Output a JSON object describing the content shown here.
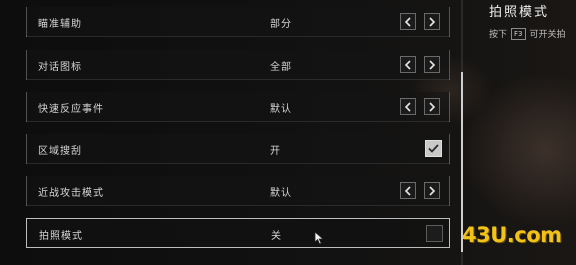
{
  "settings": {
    "rows": [
      {
        "label": "瞄准辅助",
        "value": "部分",
        "type": "selector"
      },
      {
        "label": "对话图标",
        "value": "全部",
        "type": "selector"
      },
      {
        "label": "快速反应事件",
        "value": "默认",
        "type": "selector"
      },
      {
        "label": "区域搜刮",
        "value": "开",
        "type": "toggle",
        "checked": true
      },
      {
        "label": "近战攻击模式",
        "value": "默认",
        "type": "selector"
      },
      {
        "label": "拍照模式",
        "value": "关",
        "type": "toggle",
        "checked": false
      }
    ],
    "selected_index": 5
  },
  "side_panel": {
    "title": "拍照模式",
    "hint_prefix": "按下",
    "hint_key": "F3",
    "hint_suffix": "可开关拍"
  },
  "watermark": {
    "text": "43U.com"
  },
  "icons": {
    "left_arrow": "chevron-left-icon",
    "right_arrow": "chevron-right-icon",
    "check": "checkmark-icon",
    "cursor": "mouse-cursor-icon"
  },
  "colors": {
    "accent": "#f2c21a",
    "selected_border": "#bdbdbd"
  }
}
